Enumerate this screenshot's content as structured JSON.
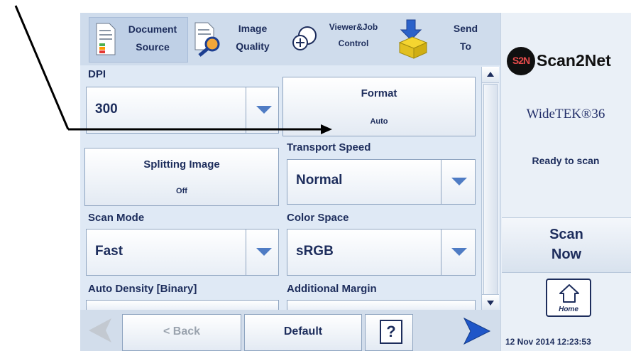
{
  "tabs": [
    {
      "line1": "Document",
      "line2": "Source",
      "icon": "document-icon"
    },
    {
      "line1": "Image",
      "line2": "Quality",
      "icon": "image-quality-icon"
    },
    {
      "line1": "Viewer&Job",
      "line2": "Control",
      "icon": "viewer-icon"
    },
    {
      "line1": "Send",
      "line2": "To",
      "icon": "send-icon"
    }
  ],
  "fields": {
    "dpi": {
      "label": "DPI",
      "value": "300"
    },
    "format": {
      "title": "Format",
      "value": "Auto"
    },
    "splitting": {
      "title": "Splitting Image",
      "value": "Off"
    },
    "transport_speed": {
      "label": "Transport Speed",
      "value": "Normal"
    },
    "scan_mode": {
      "label": "Scan Mode",
      "value": "Fast"
    },
    "color_space": {
      "label": "Color Space",
      "value": "sRGB"
    },
    "auto_density": {
      "label": "Auto Density [Binary]"
    },
    "additional_margin": {
      "label": "Additional Margin"
    }
  },
  "bottom": {
    "back_label": "< Back",
    "default_label": "Default",
    "help_label": "?"
  },
  "right_panel": {
    "brand": "Scan2Net",
    "logo_letters": "S2N",
    "model": "WideTEK®36",
    "status": "Ready to scan",
    "scan_now_line1": "Scan",
    "scan_now_line2": "Now",
    "home_label": "Home",
    "timestamp": "12 Nov 2014 12:23:53"
  },
  "colors": {
    "accent": "#4f7cc4",
    "text": "#1d2d5c",
    "panel": "#dfe9f5"
  }
}
